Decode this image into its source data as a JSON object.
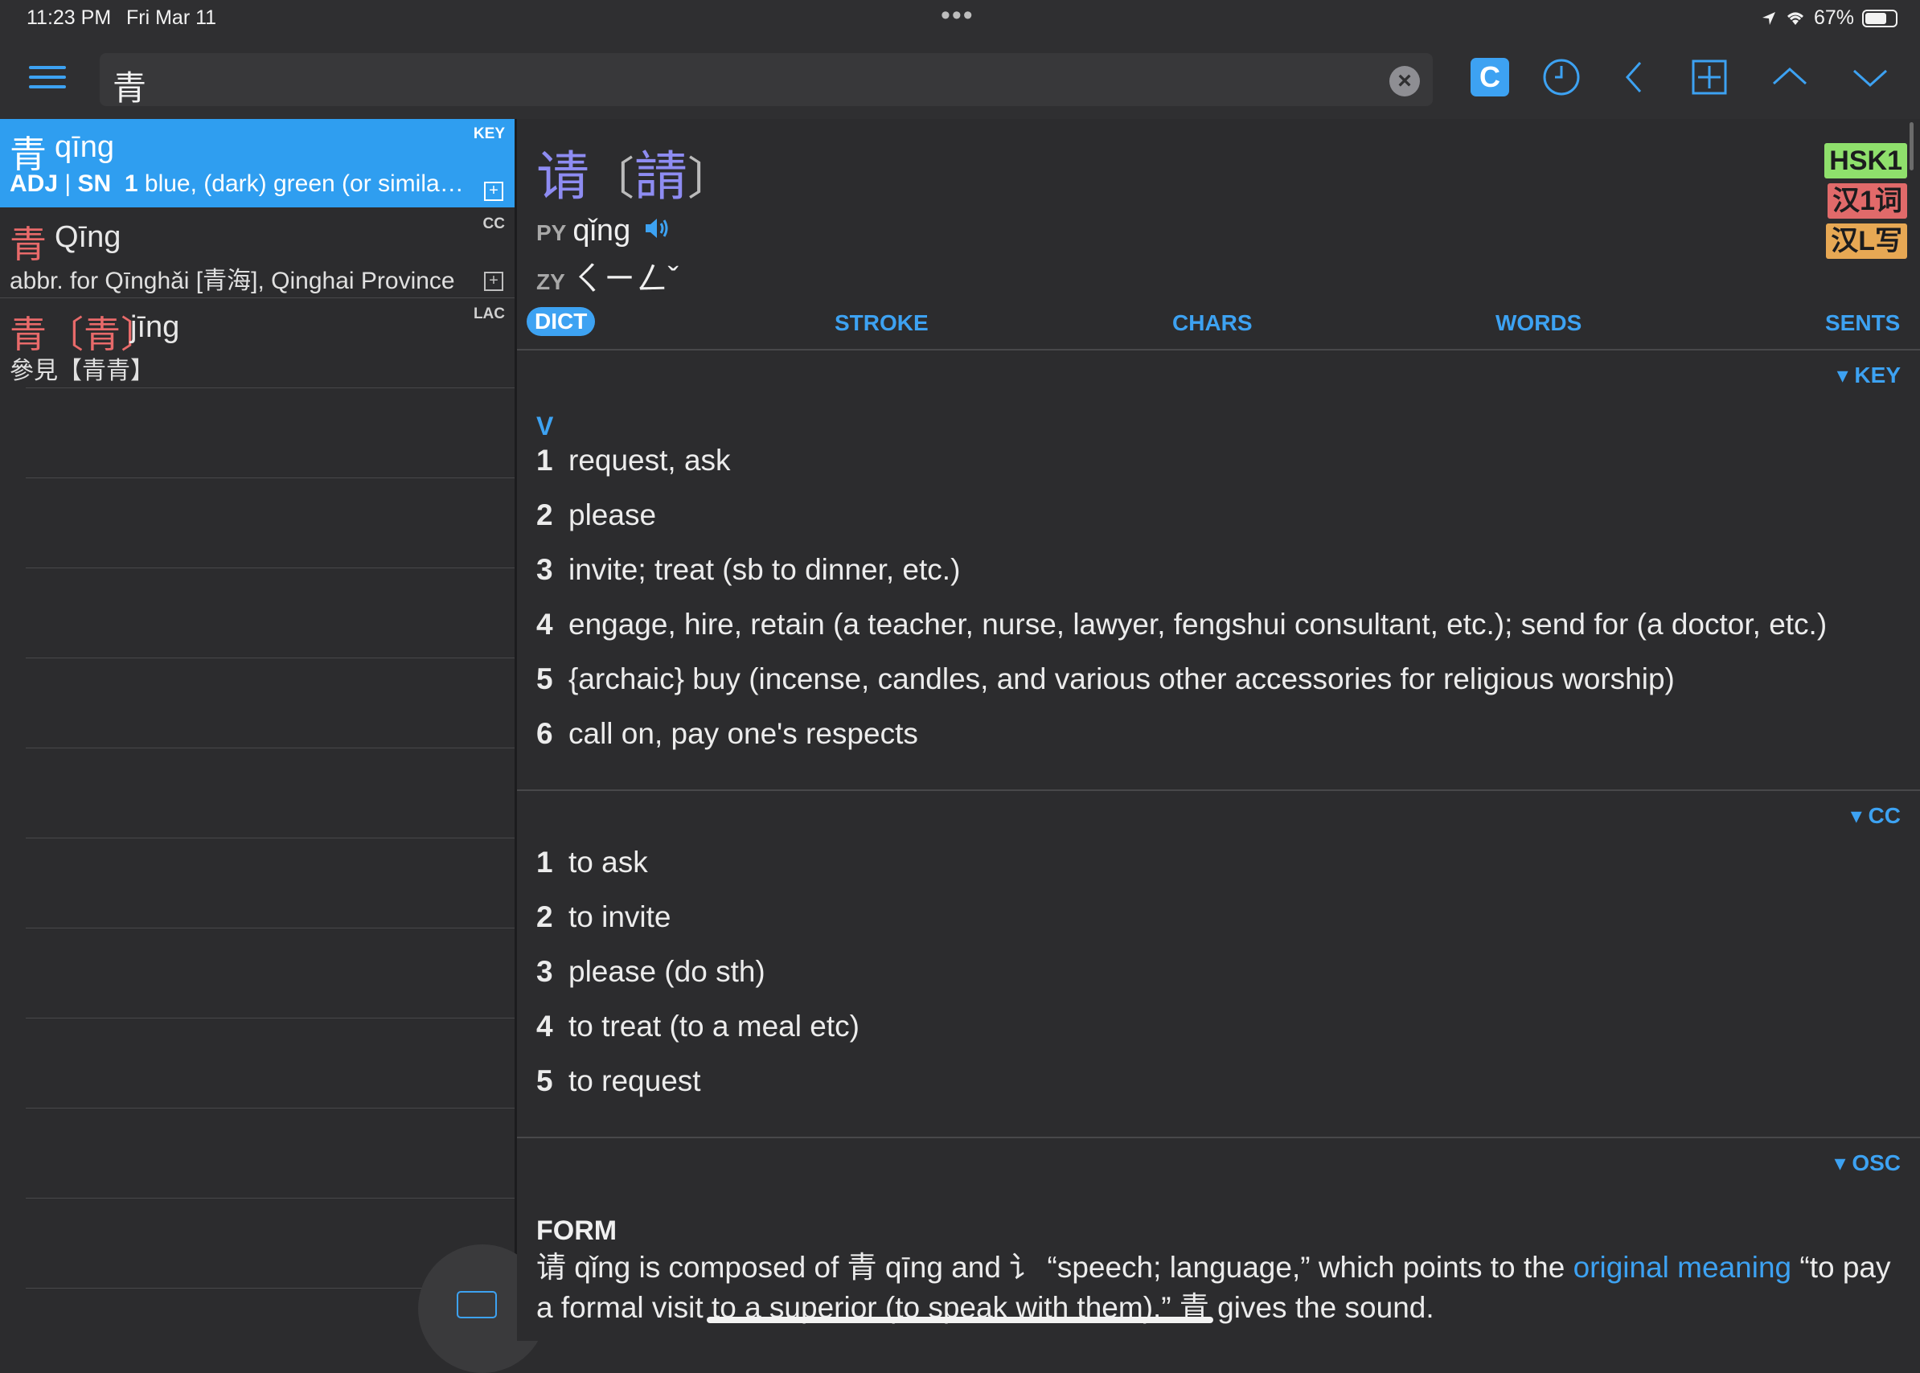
{
  "status": {
    "time": "11:23 PM",
    "date": "Fri Mar 11",
    "dots": "•••",
    "battery": "67%"
  },
  "search": {
    "query": "青"
  },
  "toolbar": {
    "c_label": "C"
  },
  "results": [
    {
      "headword": "青",
      "trad": "",
      "pinyin": "qīng",
      "source": "KEY",
      "definition_pos": "ADJ",
      "definition_sep": "|",
      "definition_sn": "SN",
      "definition_num": "1",
      "definition": "blue, (dark) green (or similar …",
      "selected": true
    },
    {
      "headword": "青",
      "trad": "",
      "pinyin": "Qīng",
      "source": "CC",
      "definition": "abbr. for Qīnghǎi [青海], Qinghai Province",
      "selected": false
    },
    {
      "headword": "青",
      "trad": "〔青〕",
      "pinyin": "jīng",
      "source": "LAC",
      "definition": "參見【青青】",
      "selected": false
    }
  ],
  "entry": {
    "simplified": "请",
    "traditional": "請",
    "bracket_open": "〔",
    "bracket_close": "〕",
    "py_label": "PY",
    "pinyin": "qǐng",
    "zy_label": "ZY",
    "zhuyin": "ㄑㄧㄥˇ",
    "badges": [
      "HSK1",
      "汉1词",
      "汉L写"
    ]
  },
  "tabs": [
    "DICT",
    "STROKE",
    "CHARS",
    "WORDS",
    "SENTS"
  ],
  "sections": {
    "key": {
      "header": "▾ KEY",
      "pos": "V",
      "senses": [
        {
          "n": "1",
          "text": "request, ask"
        },
        {
          "n": "2",
          "text": "please"
        },
        {
          "n": "3",
          "text": "invite; treat (sb to dinner, etc.)"
        },
        {
          "n": "4",
          "text": "engage, hire, retain (a teacher, nurse, lawyer, fengshui consultant, etc.); send for (a doctor, etc.)"
        },
        {
          "n": "5",
          "text": "{archaic} buy (incense, candles, and various other accessories for religious worship)"
        },
        {
          "n": "6",
          "text": "call on, pay one's respects"
        }
      ]
    },
    "cc": {
      "header": "▾ CC",
      "senses": [
        {
          "n": "1",
          "text": "to ask"
        },
        {
          "n": "2",
          "text": "to invite"
        },
        {
          "n": "3",
          "text": "please (do sth)"
        },
        {
          "n": "4",
          "text": "to treat (to a meal etc)"
        },
        {
          "n": "5",
          "text": "to request"
        }
      ]
    },
    "osc": {
      "header": "▾ OSC",
      "form_title": "FORM",
      "text_before": "请 qǐng is composed of 青 qīng and 讠 “speech; language,” which points to the ",
      "link": "original meaning",
      "text_after": " “to pay a formal visit to a superior (to speak with them).” 青 gives the sound."
    }
  }
}
